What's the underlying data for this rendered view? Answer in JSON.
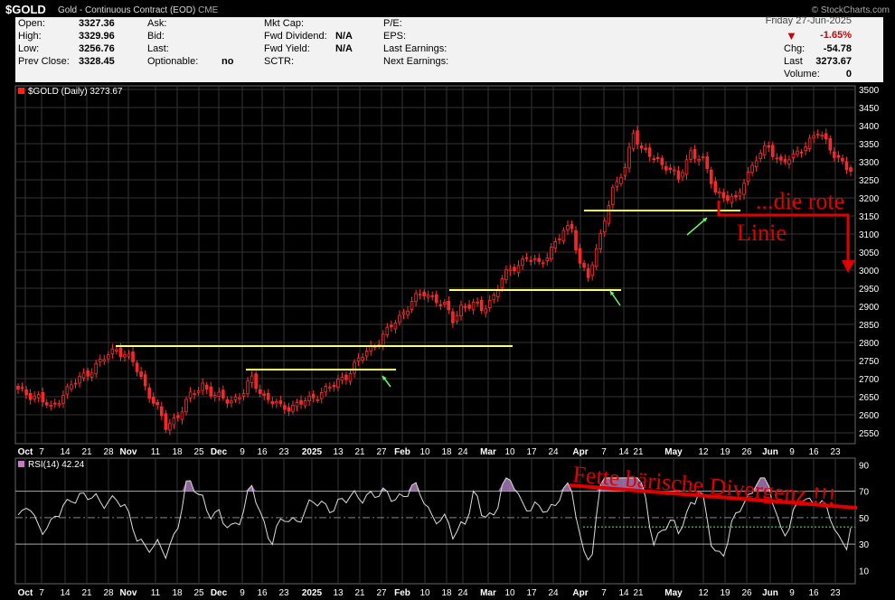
{
  "header": {
    "symbol": "$GOLD",
    "description": "Gold - Continuous Contract (EOD)",
    "exchange": "CME",
    "source": "© StockCharts.com",
    "date": "Friday  27-Jun-2025"
  },
  "quote": {
    "col1": [
      {
        "label": "Open:",
        "value": "3327.36"
      },
      {
        "label": "High:",
        "value": "3329.96"
      },
      {
        "label": "Low:",
        "value": "3256.76"
      },
      {
        "label": "Prev Close:",
        "value": "3328.45"
      }
    ],
    "col2": [
      {
        "label": "Ask:",
        "value": ""
      },
      {
        "label": "Bid:",
        "value": ""
      },
      {
        "label": "Last:",
        "value": ""
      },
      {
        "label": "Optionable:",
        "value": "no"
      }
    ],
    "col3": [
      {
        "label": "Mkt Cap:",
        "value": ""
      },
      {
        "label": "Fwd Dividend:",
        "value": "N/A"
      },
      {
        "label": "Fwd Yield:",
        "value": "N/A"
      },
      {
        "label": "SCTR:",
        "value": ""
      }
    ],
    "col4": [
      {
        "label": "P/E:",
        "value": ""
      },
      {
        "label": "EPS:",
        "value": ""
      },
      {
        "label": "Last Earnings:",
        "value": ""
      },
      {
        "label": "Next Earnings:",
        "value": ""
      }
    ],
    "pct_change": "-1.65%",
    "chg_label": "Chg:",
    "chg_value": "-54.78",
    "last_label": "Last",
    "last_value": "3273.67",
    "volume_label": "Volume:",
    "volume_value": "0",
    "down_arrow_color": "#d00000"
  },
  "chart_data": [
    {
      "type": "candlestick",
      "legend": "$GOLD (Daily) 3273.67",
      "y_ticks": [
        2550,
        2600,
        2650,
        2700,
        2750,
        2800,
        2850,
        2900,
        2950,
        3000,
        3050,
        3100,
        3150,
        3200,
        3250,
        3300,
        3350,
        3400,
        3450,
        3500
      ],
      "ylim": [
        2520,
        3510
      ],
      "x_labels": [
        "Oct",
        "7",
        "14",
        "21",
        "28",
        "Nov",
        "11",
        "18",
        "25",
        "Dec",
        "9",
        "16",
        "23",
        "2025",
        "13",
        "21",
        "27",
        "Feb",
        "10",
        "18",
        "24",
        "Mar",
        "10",
        "17",
        "24",
        "Apr",
        "7",
        "14",
        "21",
        "May",
        "12",
        "19",
        "26",
        "Jun",
        "9",
        "16",
        "23"
      ],
      "close_anchors": [
        [
          0,
          2665
        ],
        [
          5,
          2650
        ],
        [
          8,
          2615
        ],
        [
          11,
          2660
        ],
        [
          15,
          2700
        ],
        [
          20,
          2745
        ],
        [
          24,
          2785
        ],
        [
          28,
          2745
        ],
        [
          31,
          2680
        ],
        [
          34,
          2615
        ],
        [
          36,
          2565
        ],
        [
          39,
          2600
        ],
        [
          42,
          2650
        ],
        [
          45,
          2685
        ],
        [
          48,
          2650
        ],
        [
          52,
          2640
        ],
        [
          55,
          2660
        ],
        [
          57,
          2700
        ],
        [
          60,
          2650
        ],
        [
          64,
          2620
        ],
        [
          67,
          2625
        ],
        [
          71,
          2640
        ],
        [
          74,
          2665
        ],
        [
          77,
          2680
        ],
        [
          80,
          2710
        ],
        [
          83,
          2750
        ],
        [
          86,
          2785
        ],
        [
          90,
          2830
        ],
        [
          93,
          2870
        ],
        [
          96,
          2915
        ],
        [
          99,
          2935
        ],
        [
          102,
          2920
        ],
        [
          104,
          2900
        ],
        [
          106,
          2860
        ],
        [
          108,
          2900
        ],
        [
          111,
          2905
        ],
        [
          113,
          2890
        ],
        [
          116,
          2930
        ],
        [
          118,
          2975
        ],
        [
          121,
          3010
        ],
        [
          124,
          3035
        ],
        [
          127,
          3015
        ],
        [
          130,
          3060
        ],
        [
          133,
          3105
        ],
        [
          135,
          3120
        ],
        [
          137,
          3020
        ],
        [
          139,
          2980
        ],
        [
          141,
          3050
        ],
        [
          143,
          3150
        ],
        [
          145,
          3220
        ],
        [
          148,
          3280
        ],
        [
          150,
          3390
        ],
        [
          152,
          3330
        ],
        [
          155,
          3310
        ],
        [
          158,
          3290
        ],
        [
          161,
          3250
        ],
        [
          164,
          3330
        ],
        [
          167,
          3300
        ],
        [
          170,
          3220
        ],
        [
          173,
          3200
        ],
        [
          175,
          3190
        ],
        [
          177,
          3250
        ],
        [
          180,
          3310
        ],
        [
          183,
          3340
        ],
        [
          186,
          3300
        ],
        [
          189,
          3310
        ],
        [
          192,
          3350
        ],
        [
          195,
          3380
        ],
        [
          198,
          3340
        ],
        [
          200,
          3310
        ],
        [
          202,
          3280
        ],
        [
          203,
          3273.67
        ]
      ],
      "support_lines": [
        {
          "from": "28",
          "to": "10",
          "value": 2790
        },
        {
          "from": "9",
          "to": "27",
          "value": 2725
        },
        {
          "from": "18",
          "to": "14",
          "value": 2945
        },
        {
          "from": "7",
          "to": "26",
          "value": 3165
        }
      ]
    },
    {
      "type": "line",
      "legend": "RSI(14) 42.24",
      "y_ticks": [
        10,
        30,
        50,
        70,
        90
      ],
      "ylim": [
        0,
        95
      ],
      "overbought": 70,
      "oversold": 30,
      "midline": 50,
      "support_level": 43
    }
  ],
  "annotations": {
    "rote_linie_1": "...die rote",
    "rote_linie_2": "Linie",
    "divergence": "Fette bärische Divergenz !!!",
    "annotation_color": "#e00000",
    "yellow_line_color": "#ffff66",
    "green_arrow_color": "#66ff66"
  }
}
